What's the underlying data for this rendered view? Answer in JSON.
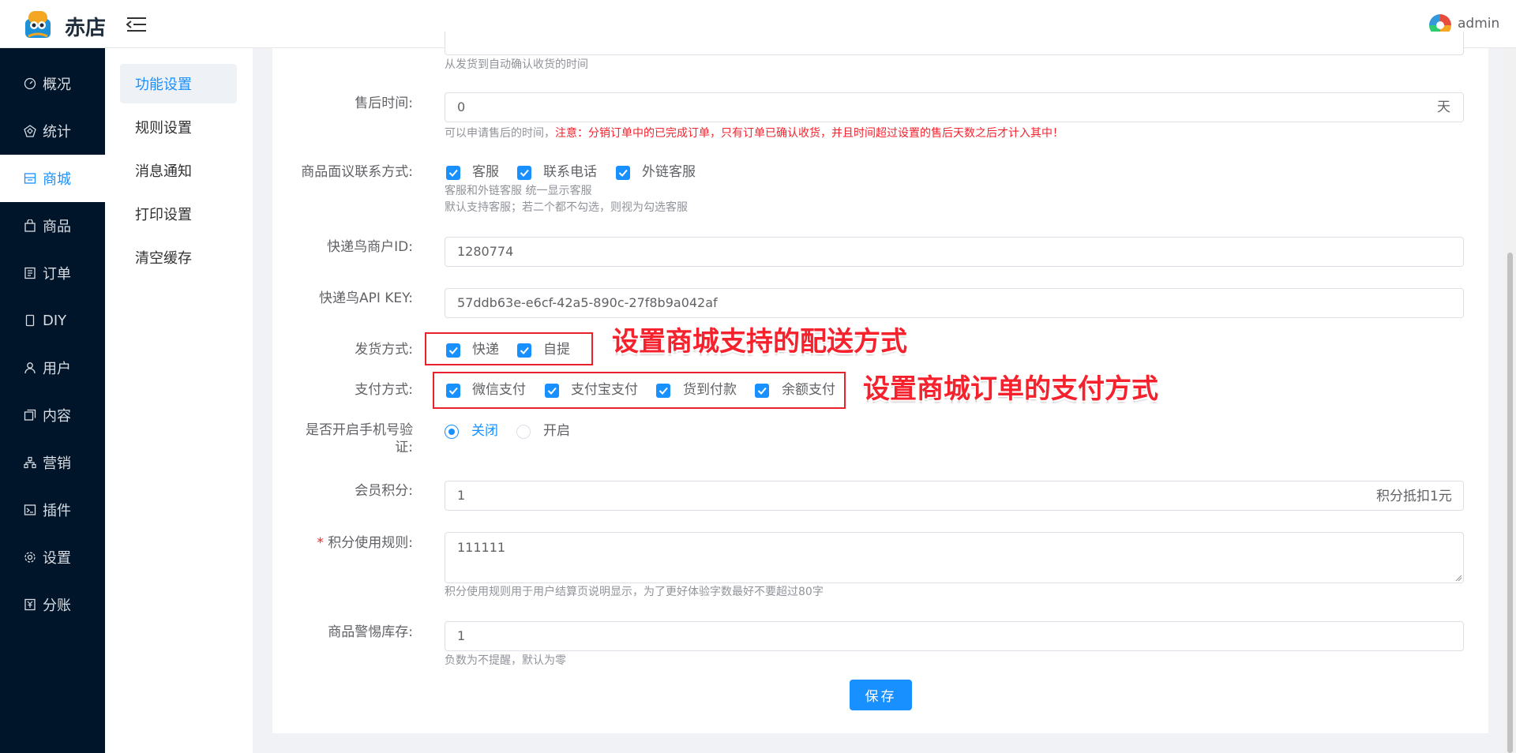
{
  "header": {
    "brand": "赤店",
    "user": "admin"
  },
  "sidebar": {
    "items": [
      {
        "label": "概况",
        "icon": "dashboard-icon"
      },
      {
        "label": "统计",
        "icon": "stats-icon"
      },
      {
        "label": "商城",
        "icon": "store-icon",
        "active": true
      },
      {
        "label": "商品",
        "icon": "bag-icon"
      },
      {
        "label": "订单",
        "icon": "order-icon"
      },
      {
        "label": "DIY",
        "icon": "phone-icon"
      },
      {
        "label": "用户",
        "icon": "user-icon"
      },
      {
        "label": "内容",
        "icon": "content-icon"
      },
      {
        "label": "营销",
        "icon": "marketing-icon"
      },
      {
        "label": "插件",
        "icon": "plugin-icon"
      },
      {
        "label": "设置",
        "icon": "gear-icon"
      },
      {
        "label": "分账",
        "icon": "split-icon"
      }
    ]
  },
  "subnav": {
    "items": [
      {
        "label": "功能设置",
        "active": true
      },
      {
        "label": "规则设置"
      },
      {
        "label": "消息通知"
      },
      {
        "label": "打印设置"
      },
      {
        "label": "清空缓存"
      }
    ]
  },
  "form": {
    "confirm_hint": "从发货到自动确认收货的时间",
    "after_sale": {
      "label": "售后时间:",
      "value": "0",
      "suffix": "天",
      "hint_plain": "可以申请售后的时间，",
      "hint_warn": "注意：分销订单中的已完成订单，只有订单已确认收货，并且时间超过设置的售后天数之后才计入其中！"
    },
    "contact": {
      "label": "商品面议联系方式:",
      "options": [
        "客服",
        "联系电话",
        "外链客服"
      ],
      "hint1": "客服和外链客服 统一显示客服",
      "hint2": "默认支持客服；若二个都不勾选，则视为勾选客服"
    },
    "kdn_id": {
      "label": "快递鸟商户ID:",
      "value": "1280774"
    },
    "kdn_key": {
      "label": "快递鸟API KEY:",
      "value": "57ddb63e-e6cf-42a5-890c-27f8b9a042af"
    },
    "delivery": {
      "label": "发货方式:",
      "options": [
        "快递",
        "自提"
      ]
    },
    "payment": {
      "label": "支付方式:",
      "options": [
        "微信支付",
        "支付宝支付",
        "货到付款",
        "余额支付"
      ]
    },
    "sms": {
      "label_line1": "是否开启手机号验",
      "label_line2": "证:",
      "options": [
        "关闭",
        "开启"
      ],
      "selected": "关闭"
    },
    "points": {
      "label": "会员积分:",
      "value": "1",
      "suffix": "积分抵扣1元"
    },
    "points_rule": {
      "required_mark": "*",
      "label": "积分使用规则:",
      "value": "111111",
      "hint": "积分使用规则用于用户结算页说明显示，为了更好体验字数最好不要超过80字"
    },
    "stock_alert": {
      "label": "商品警惕库存:",
      "value": "1",
      "hint": "负数为不提醒，默认为零"
    },
    "save": "保存"
  },
  "annotations": {
    "delivery": "设置商城支持的配送方式",
    "payment": "设置商城订单的支付方式"
  }
}
